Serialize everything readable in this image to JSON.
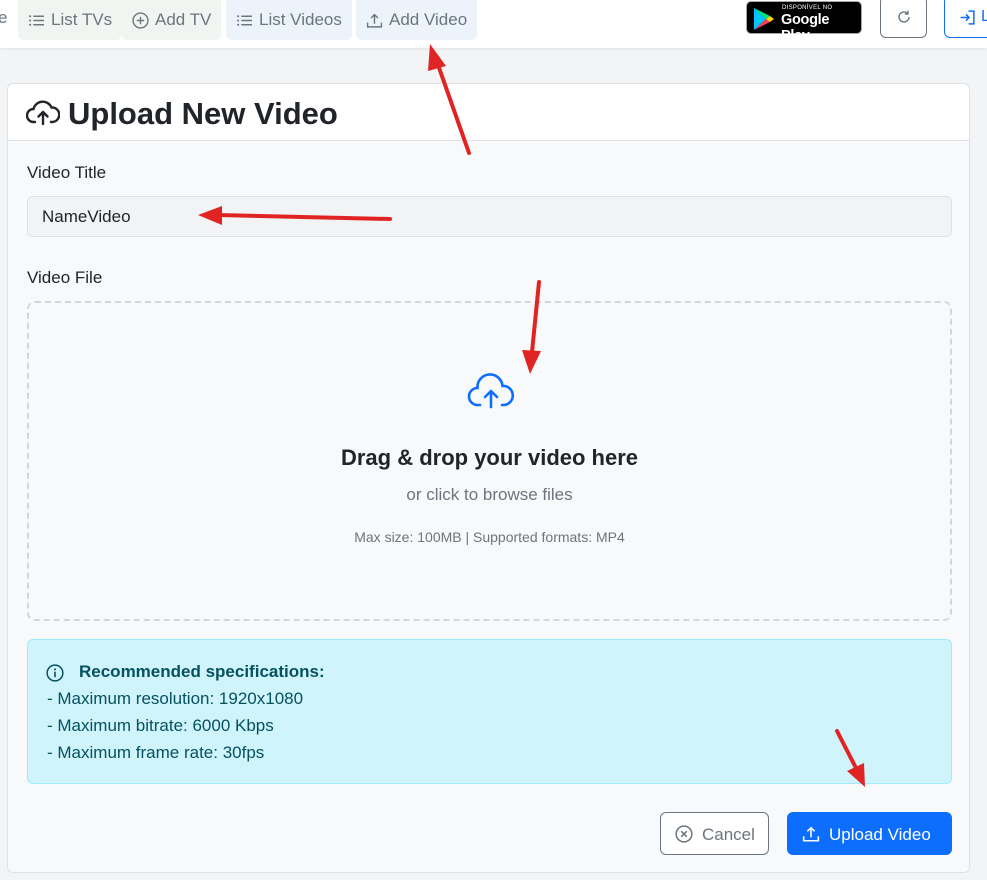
{
  "nav": {
    "cut_text": "e",
    "items": [
      {
        "label": "List TVs",
        "icon": "list-icon"
      },
      {
        "label": "Add TV",
        "icon": "plus-circle-icon"
      },
      {
        "label": "List Videos",
        "icon": "list-icon"
      },
      {
        "label": "Add Video",
        "icon": "upload-icon"
      }
    ],
    "google_play": {
      "small_text": "DISPONÍVEL NO",
      "big_text": "Google Play"
    },
    "refresh_icon": "refresh-icon",
    "login_text": "L"
  },
  "card": {
    "title": "Upload New Video",
    "title_icon": "cloud-upload-icon"
  },
  "form": {
    "title_label": "Video Title",
    "title_value": "NameVideo",
    "file_label": "Video File",
    "dropzone": {
      "icon": "cloud-upload-icon",
      "title": "Drag & drop your video here",
      "subtitle": "or click to browse files",
      "note": "Max size: 100MB | Supported formats: MP4"
    }
  },
  "info": {
    "icon": "info-circle-icon",
    "title": "Recommended specifications:",
    "lines": [
      "- Maximum resolution: 1920x1080",
      "- Maximum bitrate: 6000 Kbps",
      "- Maximum frame rate: 30fps"
    ]
  },
  "buttons": {
    "cancel": "Cancel",
    "upload": "Upload Video"
  },
  "colors": {
    "primary": "#0d6efd",
    "secondary": "#6c757d",
    "info_bg": "#cff4fc",
    "info_text": "#055160",
    "annotation_arrow": "#e02424"
  }
}
